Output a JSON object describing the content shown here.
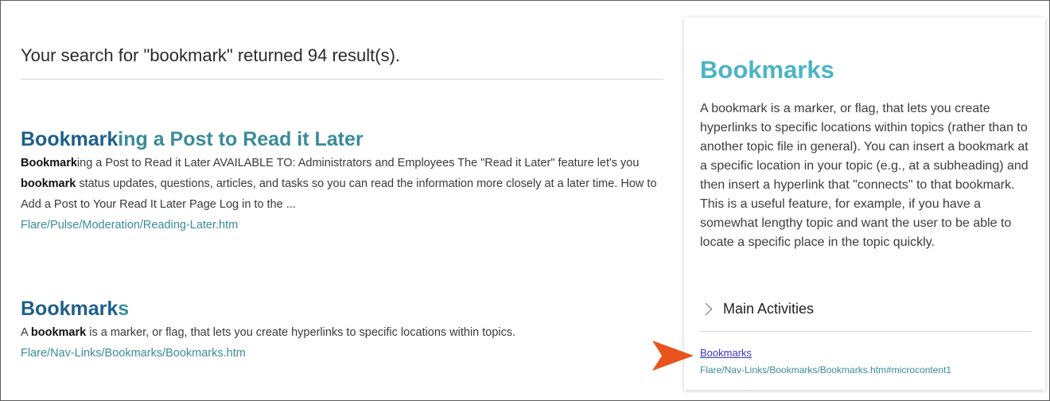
{
  "search": {
    "summary": "Your search for \"bookmark\" returned 94 result(s)."
  },
  "results": [
    {
      "title_highlight": "Bookmark",
      "title_rest": "ing a Post to Read it Later",
      "snippet_1_bold": "Bookmark",
      "snippet_1": "ing a Post to Read it Later AVAILABLE TO: Administrators and Employees The \"Read it Later\" feature let's you ",
      "snippet_2_bold": "bookmark",
      "snippet_2": " status updates, questions, articles, and tasks so you can read the information more closely at a later time. How to Add a Post to Your Read It Later Page Log in to the ...",
      "url": "Flare/Pulse/Moderation/Reading-Later.htm"
    },
    {
      "title_highlight": "Bookmark",
      "title_rest": "s",
      "snippet_pre": "A ",
      "snippet_bold": "bookmark",
      "snippet_post": " is a marker, or flag, that lets you create hyperlinks to specific locations within topics.",
      "url": "Flare/Nav-Links/Bookmarks/Bookmarks.htm"
    }
  ],
  "microcontent": {
    "title": "Bookmarks",
    "body": "A bookmark is a marker, or flag, that lets you create hyperlinks to specific locations within topics (rather than to another topic file in general). You can insert a bookmark at a specific location in your topic (e.g., at a subheading) and then insert a hyperlink that \"connects\" to that bookmark. This is a useful feature, for example, if you have a somewhat lengthy topic and want the user to be able to locate a specific place in the topic quickly.",
    "activities_label": "Main Activities",
    "link_label": "Bookmarks",
    "link_url": "Flare/Nav-Links/Bookmarks/Bookmarks.htm#microcontent1"
  },
  "colors": {
    "accent": "#3a8c99",
    "highlight": "#1e5f8a",
    "callout_arrow": "#e8541e"
  },
  "icons": {
    "expander": "chevron-right-icon",
    "callout": "callout-arrow-icon"
  }
}
